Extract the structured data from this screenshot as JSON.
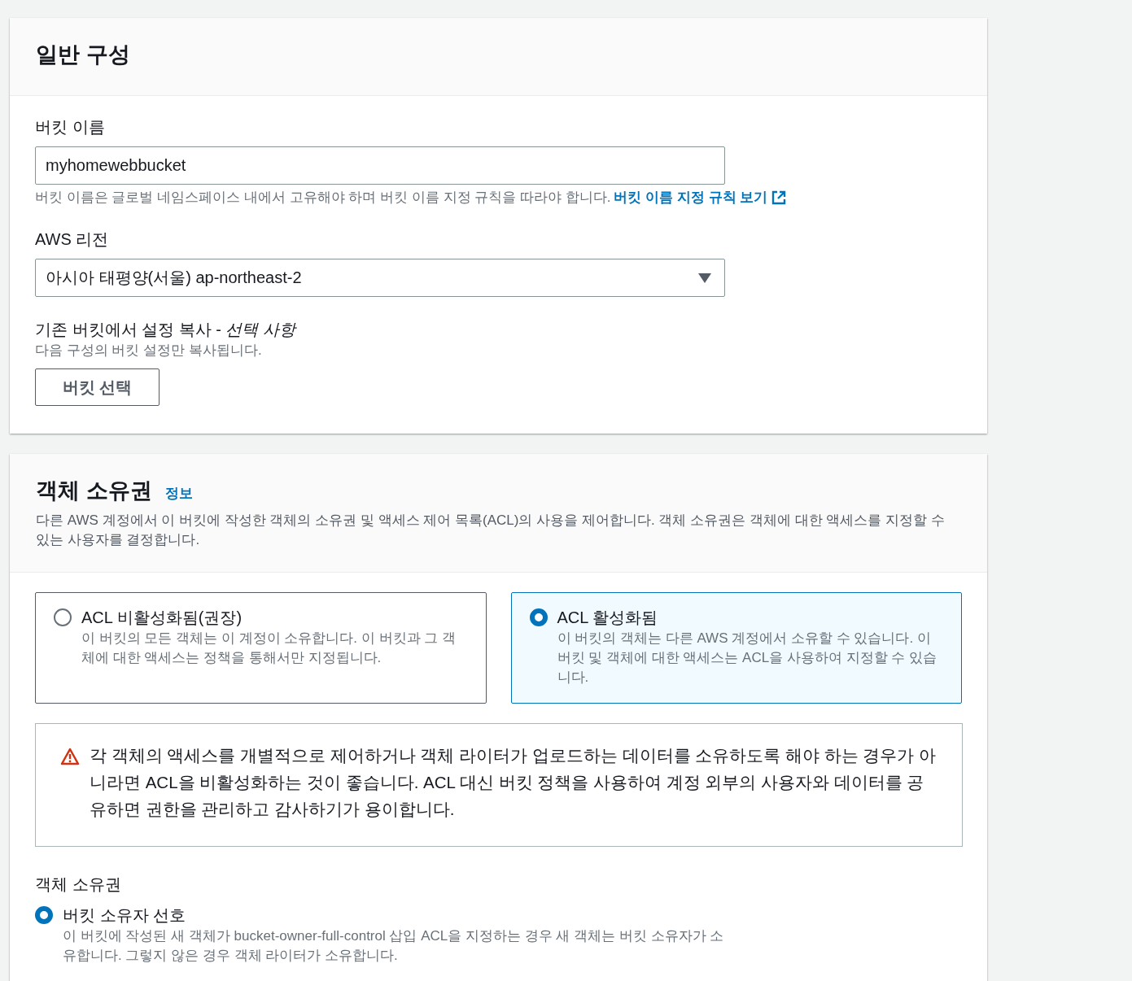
{
  "general": {
    "title": "일반 구성",
    "bucket_name": {
      "label": "버킷 이름",
      "value": "myhomewebbucket",
      "hint": "버킷 이름은 글로벌 네임스페이스 내에서 고유해야 하며 버킷 이름 지정 규칙을 따라야 합니다.",
      "link": "버킷 이름 지정 규칙 보기"
    },
    "region": {
      "label": "AWS 리전",
      "value": "아시아 태평양(서울) ap-northeast-2"
    },
    "copy": {
      "label": "기존 버킷에서 설정 복사 - *선택 사항*",
      "description": "다음 구성의 버킷 설정만 복사됩니다.",
      "button": "버킷 선택"
    }
  },
  "ownership": {
    "title": "객체 소유권",
    "info": "정보",
    "description": "다른 AWS 계정에서 이 버킷에 작성한 객체의 소유권 및 액세스 제어 목록(ACL)의 사용을 제어합니다. 객체 소유권은 객체에 대한 액세스를 지정할 수 있는 사용자를 결정합니다.",
    "acl_options": [
      {
        "label": "ACL 비활성화됨(권장)",
        "description": "이 버킷의 모든 객체는 이 계정이 소유합니다. 이 버킷과 그 객체에 대한 액세스는 정책을 통해서만 지정됩니다.",
        "selected": false
      },
      {
        "label": "ACL 활성화됨",
        "description": "이 버킷의 객체는 다른 AWS 계정에서 소유할 수 있습니다. 이 버킷 및 객체에 대한 액세스는 ACL을 사용하여 지정할 수 있습니다.",
        "selected": true
      }
    ],
    "warning": "각 객체의 액세스를 개별적으로 제어하거나 객체 라이터가 업로드하는 데이터를 소유하도록 해야 하는 경우가 아니라면 ACL을 비활성화하는 것이 좋습니다. ACL 대신 버킷 정책을 사용하여 계정 외부의 사용자와 데이터를 공유하면 권한을 관리하고 감사하기가 용이합니다.",
    "field_label": "객체 소유권",
    "options": [
      {
        "label": "버킷 소유자 선호",
        "description": "이 버킷에 작성된 새 객체가 bucket-owner-full-control 삽입 ACL을 지정하는 경우 새 객체는 버킷 소유자가 소유합니다. 그렇지 않은 경우 객체 라이터가 소유합니다.",
        "selected": true
      }
    ]
  }
}
